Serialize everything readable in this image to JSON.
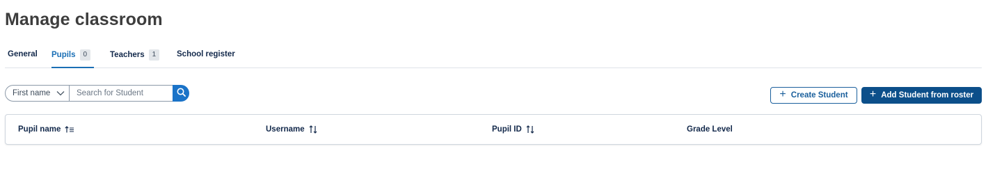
{
  "page": {
    "title": "Manage classroom"
  },
  "tabs": [
    {
      "label": "General"
    },
    {
      "label": "Pupils",
      "count": "0",
      "active": true
    },
    {
      "label": "Teachers",
      "count": "1"
    },
    {
      "label": "School register"
    }
  ],
  "search": {
    "field_selected": "First name",
    "placeholder": "Search for Student",
    "value": ""
  },
  "actions": {
    "create_student": "Create Student",
    "add_from_roster": "Add Student from roster"
  },
  "table": {
    "columns": [
      {
        "label": "Pupil name",
        "sort_icon": "sort-ascending-icon"
      },
      {
        "label": "Username",
        "sort_icon": "sort-icon"
      },
      {
        "label": "Pupil ID",
        "sort_icon": "sort-icon"
      },
      {
        "label": "Grade Level"
      }
    ],
    "rows": []
  },
  "colors": {
    "accent": "#1a6fb5",
    "primary_button": "#0c4f8a",
    "search_button": "#1a73c8",
    "title": "#3d3d3d"
  }
}
